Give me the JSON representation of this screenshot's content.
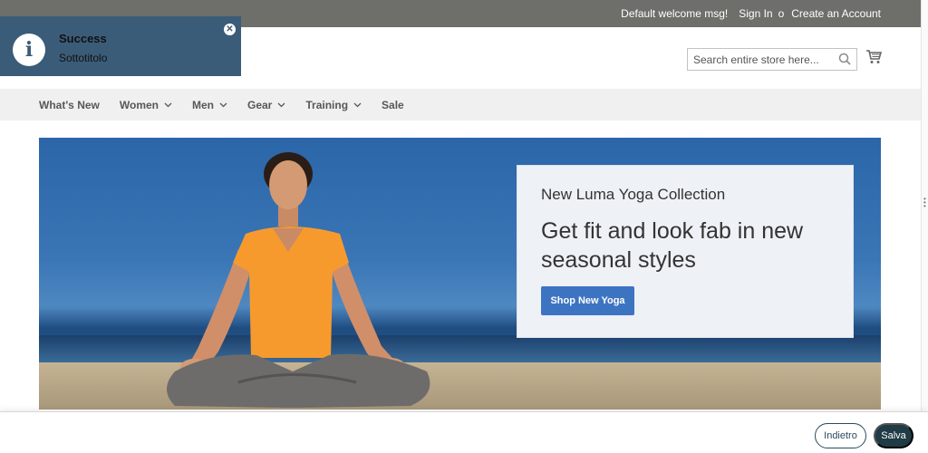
{
  "topbar": {
    "welcome": "Default welcome msg!",
    "sign_in": "Sign In",
    "separator": "o",
    "create_account": "Create an Account"
  },
  "search": {
    "placeholder": "Search entire store here...",
    "icon": "search-icon"
  },
  "cart": {
    "icon": "cart-icon"
  },
  "nav": {
    "items": [
      {
        "label": "What's New",
        "has_dropdown": false
      },
      {
        "label": "Women",
        "has_dropdown": true
      },
      {
        "label": "Men",
        "has_dropdown": true
      },
      {
        "label": "Gear",
        "has_dropdown": true
      },
      {
        "label": "Training",
        "has_dropdown": true
      },
      {
        "label": "Sale",
        "has_dropdown": false
      }
    ]
  },
  "hero": {
    "subtitle": "New Luma Yoga Collection",
    "headline": "Get fit and look fab in new seasonal styles",
    "cta": "Shop New Yoga"
  },
  "toast": {
    "title": "Success",
    "subtitle": "Sottotitolo",
    "icon": "info-icon",
    "close_icon": "close-icon"
  },
  "actions": {
    "back": "Indietro",
    "save": "Salva"
  },
  "colors": {
    "topbar": "#6e6e6b",
    "nav_bg": "#f0f0f0",
    "toast_bg": "#3b5c78",
    "cta": "#3d74c2",
    "save_button": "#1f3b45"
  }
}
